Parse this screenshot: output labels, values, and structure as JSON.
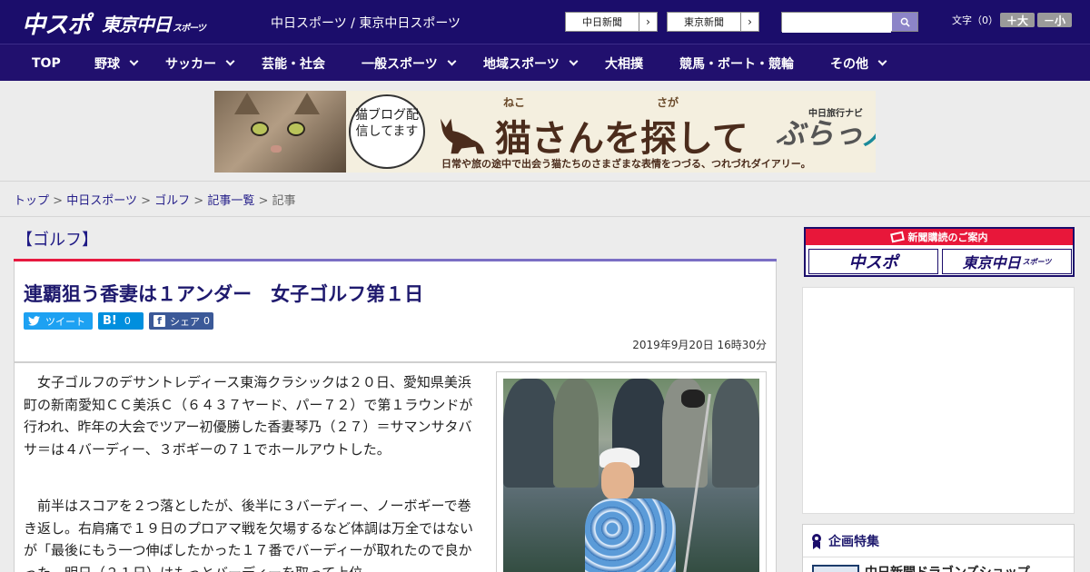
{
  "header": {
    "logo_chuspo": "中スポ",
    "logo_tokyo": "東京中日",
    "logo_tokyo_small": "スポーツ",
    "brand_title": "中日スポーツ / 東京中日スポーツ",
    "link_chunichi": "中日新聞",
    "link_tokyo": "東京新聞",
    "search_placeholder": "",
    "font_size_label": "文字（0）",
    "font_larger": "＋大",
    "font_smaller": "－小"
  },
  "nav": {
    "items": [
      {
        "label": "TOP"
      },
      {
        "label": "野球"
      },
      {
        "label": "サッカー"
      },
      {
        "label": "芸能・社会"
      },
      {
        "label": "一般スポーツ"
      },
      {
        "label": "地域スポーツ"
      },
      {
        "label": "大相撲"
      },
      {
        "label": "競馬・ボート・競輪"
      },
      {
        "label": "その他"
      }
    ]
  },
  "banner": {
    "bubble_text": "猫ブログ配信してます",
    "title": "猫さんを探して",
    "ruby_neko": "ねこ",
    "ruby_saga": "さが",
    "subtitle": "日常や旅の途中で出会う猫たちのさまざまな表情をつづる、つれづれダイアリー。",
    "navi_label": "中日旅行ナビ",
    "brand": "ぶらっ",
    "brand_accent": "人"
  },
  "breadcrumb": {
    "items": [
      "トップ",
      "中日スポーツ",
      "ゴルフ",
      "記事一覧"
    ],
    "separator": ">",
    "current": "記事"
  },
  "category": "【ゴルフ】",
  "article": {
    "title": "連覇狙う香妻は１アンダー　女子ゴルフ第１日",
    "tweet_label": "ツイート",
    "hatena_label": "B!",
    "hatena_count": "0",
    "fb_label": "シェア",
    "fb_count": "0",
    "date": "2019年9月20日 16時30分",
    "paragraphs": [
      "　女子ゴルフのデサントレディース東海クラシックは２０日、愛知県美浜町の新南愛知ＣＣ美浜Ｃ（６４３７ヤード、パー７２）で第１ラウンドが行われ、昨年の大会でツアー初優勝した香妻琴乃（２７）＝サマンサタバサ＝は４バーディー、３ボギーの７１でホールアウトした。",
      "　前半はスコアを２つ落としたが、後半に３バーディー、ノーボギーで巻き返し。右肩痛で１９日のプロアマ戦を欠場するなど体調は万全ではないが「最後にもう一つ伸ばしたかった１７番でバーディーが取れたので良かった。明日（２１日）はもっとバーディーを取って上位"
    ]
  },
  "sidebar": {
    "subscribe_title": "新聞購読のご案内",
    "subscribe_chuspo": "中スポ",
    "subscribe_tokyo": "東京中日",
    "subscribe_tokyo_small": "スポーツ",
    "feature_title": "企画特集",
    "feature_item": "中日新聞ドラゴンズショップ"
  },
  "colors": {
    "header_bg": "#1b0d6b",
    "nav_bg": "#21106e",
    "accent_red": "#e7193f",
    "link": "#26208a",
    "twitter": "#1da1f2",
    "hatena": "#008fde",
    "facebook": "#3b5998"
  }
}
